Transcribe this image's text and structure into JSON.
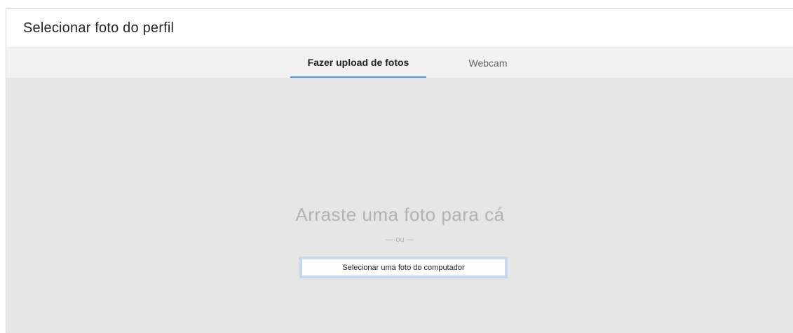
{
  "dialog": {
    "title": "Selecionar foto do perfil"
  },
  "tabs": [
    {
      "label": "Fazer upload de fotos",
      "active": true
    },
    {
      "label": "Webcam",
      "active": false
    }
  ],
  "drop_zone": {
    "prompt": "Arraste uma foto para cá",
    "separator": "— ou —",
    "select_button": "Selecionar uma foto do computador"
  },
  "colors": {
    "active_tab_underline": "#4d90fe",
    "drop_zone_background": "#e6e6e6",
    "tab_bar_background": "#f1f1f1"
  }
}
